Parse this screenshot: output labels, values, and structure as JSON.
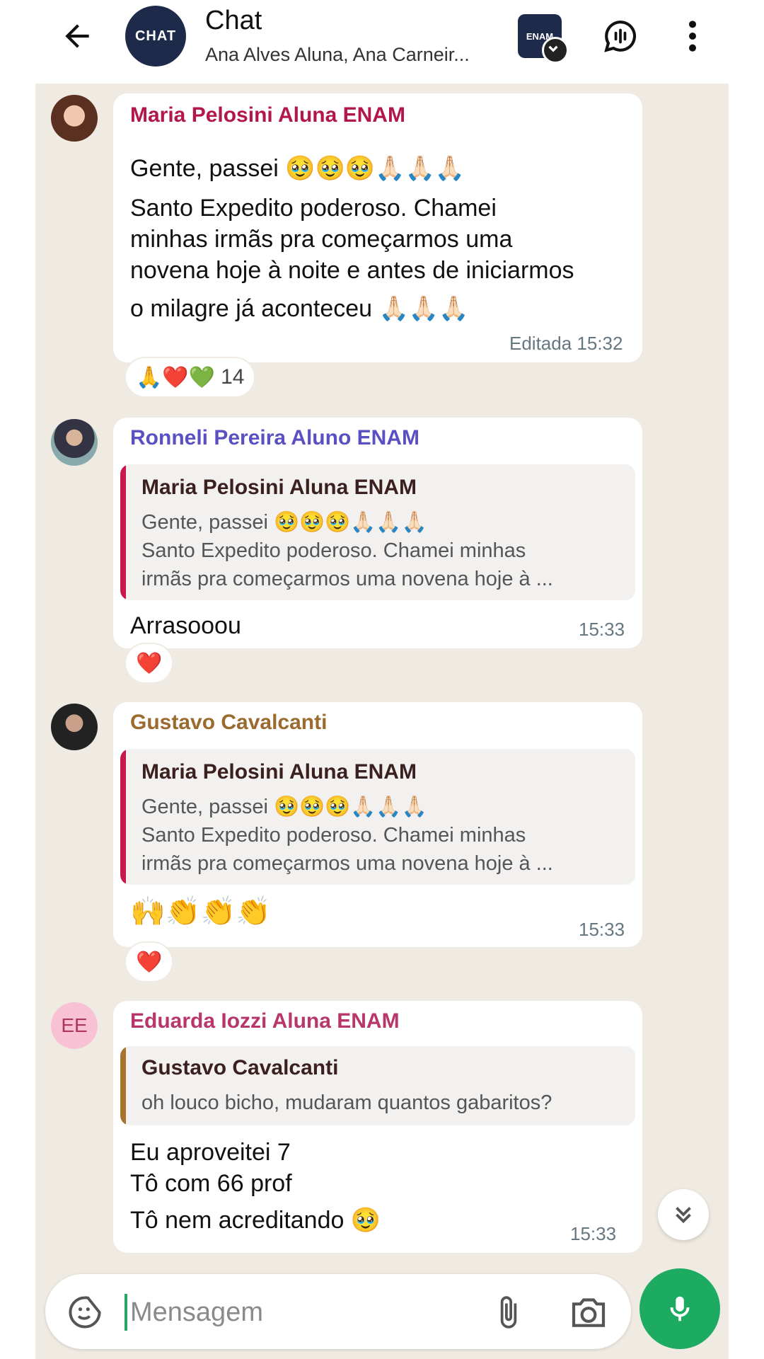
{
  "header": {
    "avatar_text": "CHAT",
    "title": "Chat",
    "subtitle": "Ana Alves Aluna, Ana Carneir...",
    "community_badge": "ENAM"
  },
  "messages": [
    {
      "sender": "Maria Pelosini Aluna ENAM",
      "sender_color": "#b3174a",
      "lines": [
        "Gente, passei 🥹🥹🥹🙏🏻🙏🏻🙏🏻",
        "Santo Expedito poderoso. Chamei",
        "minhas irmãs pra começarmos uma",
        "novena hoje à noite e antes de iniciarmos",
        "o milagre já aconteceu 🙏🏻🙏🏻🙏🏻"
      ],
      "time": "Editada 15:32",
      "reactions": "🙏❤️💚",
      "reaction_count": "14"
    },
    {
      "sender": "Ronneli Pereira Aluno ENAM",
      "sender_color": "#5b4fc4",
      "quote": {
        "name": "Maria Pelosini Aluna ENAM",
        "lines": [
          "Gente, passei 🥹🥹🥹🙏🏻🙏🏻🙏🏻",
          "Santo Expedito poderoso. Chamei minhas",
          "irmãs pra começarmos uma novena hoje à ..."
        ]
      },
      "text": "Arrasooou",
      "time": "15:33",
      "reactions": "❤️"
    },
    {
      "sender": "Gustavo Cavalcanti",
      "sender_color": "#9a6a2f",
      "quote": {
        "name": "Maria Pelosini Aluna ENAM",
        "lines": [
          "Gente, passei 🥹🥹🥹🙏🏻🙏🏻🙏🏻",
          "Santo Expedito poderoso. Chamei minhas",
          "irmãs pra começarmos uma novena hoje à ..."
        ]
      },
      "text": "🙌👏👏👏",
      "time": "15:33",
      "reactions": "❤️"
    },
    {
      "avatar_text": "EE",
      "sender": "Eduarda Iozzi Aluna ENAM",
      "sender_color": "#b8366a",
      "quote": {
        "name": "Gustavo Cavalcanti",
        "lines": [
          "oh louco bicho, mudaram quantos gabaritos?"
        ]
      },
      "lines": [
        "Eu aproveitei 7",
        "Tô com 66 prof",
        "Tô nem acreditando 🥹"
      ],
      "time": "15:33"
    }
  ],
  "composer": {
    "placeholder": "Mensagem"
  },
  "icons": {
    "back": "arrow-left-icon",
    "voice_chat": "voice-chat-icon",
    "menu": "more-vert-icon",
    "emoji": "sticker-icon",
    "attach": "paperclip-icon",
    "camera": "camera-icon",
    "mic": "mic-icon",
    "scroll": "double-chevron-down-icon"
  }
}
